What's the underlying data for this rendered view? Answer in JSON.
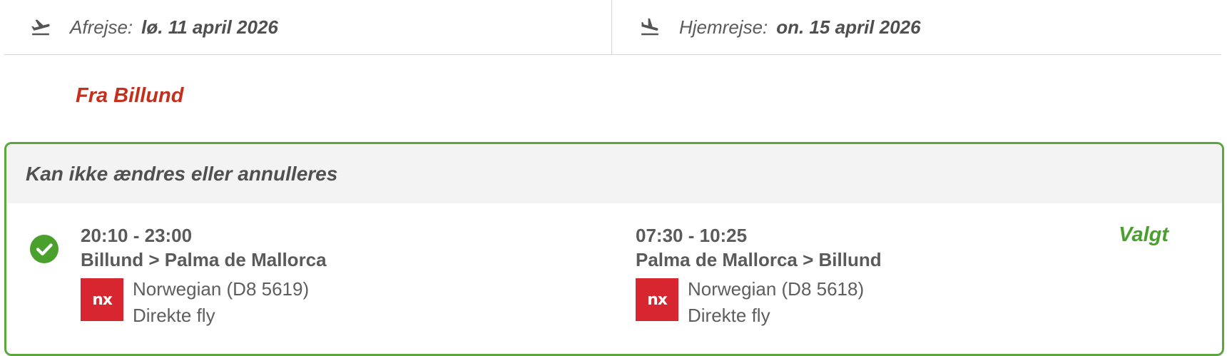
{
  "dates": {
    "outbound": {
      "icon": "plane-departure-icon",
      "label": "Afrejse:",
      "value": "lø. 11 april 2026"
    },
    "return": {
      "icon": "plane-arrival-icon",
      "label": "Hjemrejse:",
      "value": "on. 15 april 2026"
    }
  },
  "origin_heading": "Fra Billund",
  "option": {
    "header": "Kan ikke ændres eller annulleres",
    "selected_label": "Valgt",
    "selected_icon": "check-circle-icon",
    "outbound": {
      "times": "20:10 - 23:00",
      "route": "Billund > Palma de Mallorca",
      "airline_logo_text": "nx",
      "airline": "Norwegian (D8 5619)",
      "stops": "Direkte fly"
    },
    "return": {
      "times": "07:30 - 10:25",
      "route": "Palma de Mallorca > Billund",
      "airline_logo_text": "nx",
      "airline": "Norwegian (D8 5618)",
      "stops": "Direkte fly"
    }
  },
  "colors": {
    "accent_red": "#c4301c",
    "selected_green": "#4aa02c",
    "card_border": "#5aa83c",
    "airline_red": "#d7262f"
  }
}
